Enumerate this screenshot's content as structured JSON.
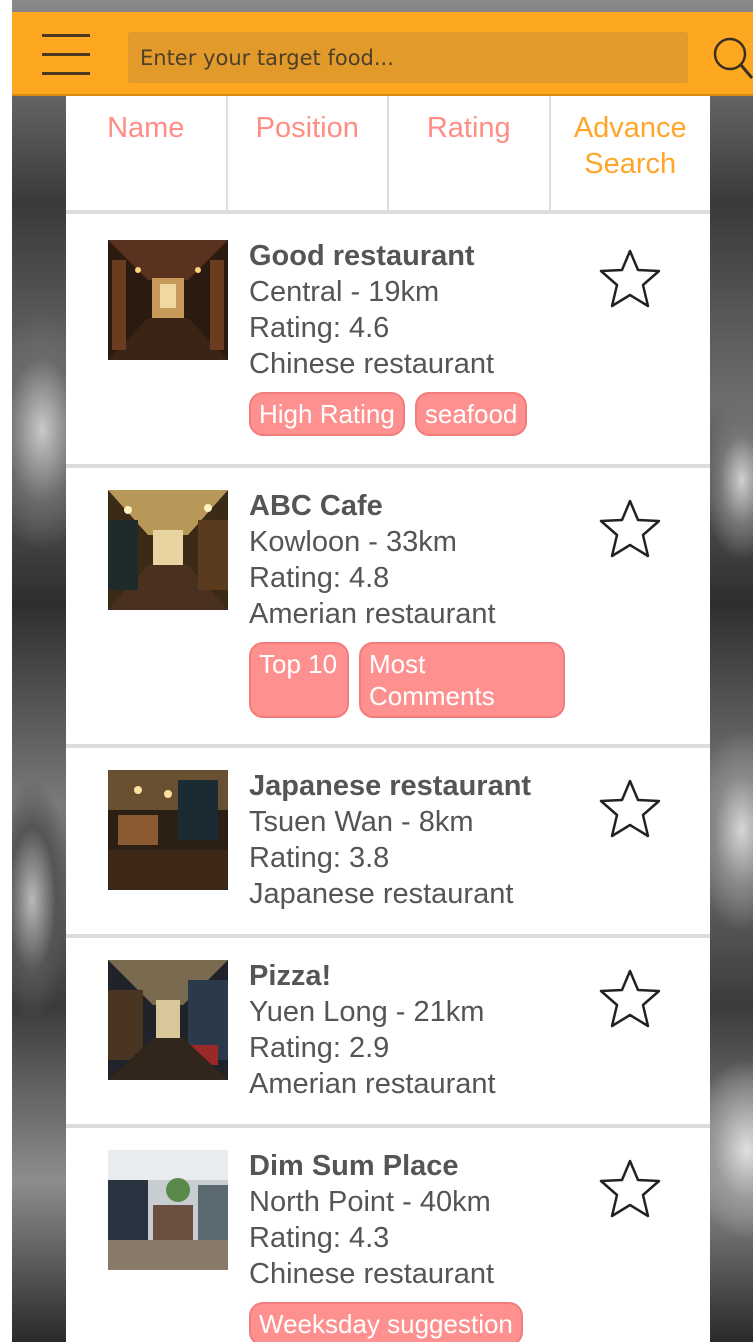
{
  "header": {
    "search_placeholder": "Enter your target food..."
  },
  "sort_tabs": [
    "Name",
    "Position",
    "Rating",
    "Advance Search"
  ],
  "restaurants": [
    {
      "name": "Good restaurant",
      "location": "Central - 19km",
      "rating": "Rating: 4.6",
      "category": "Chinese restaurant",
      "tags": [
        "High Rating",
        "seafood"
      ]
    },
    {
      "name": "ABC Cafe",
      "location": "Kowloon - 33km",
      "rating": "Rating: 4.8",
      "category": "Amerian restaurant",
      "tags": [
        "Top 10",
        "Most Comments"
      ]
    },
    {
      "name": "Japanese restaurant",
      "location": "Tsuen Wan - 8km",
      "rating": "Rating: 3.8",
      "category": "Japanese restaurant",
      "tags": []
    },
    {
      "name": "Pizza!",
      "location": "Yuen Long - 21km",
      "rating": "Rating: 2.9",
      "category": "Amerian restaurant",
      "tags": []
    },
    {
      "name": "Dim Sum Place",
      "location": "North Point - 40km",
      "rating": "Rating: 4.3",
      "category": "Chinese restaurant",
      "tags": [
        "Weeksday suggestion"
      ]
    }
  ],
  "icons": {
    "menu": "hamburger-menu-icon",
    "search": "search-icon",
    "favorite": "star-outline-icon"
  },
  "colors": {
    "header": "#fea720",
    "sort_label": "#ff8d85",
    "advance_label": "#ffa62a",
    "tag": "#fe9090",
    "text": "#555555"
  }
}
